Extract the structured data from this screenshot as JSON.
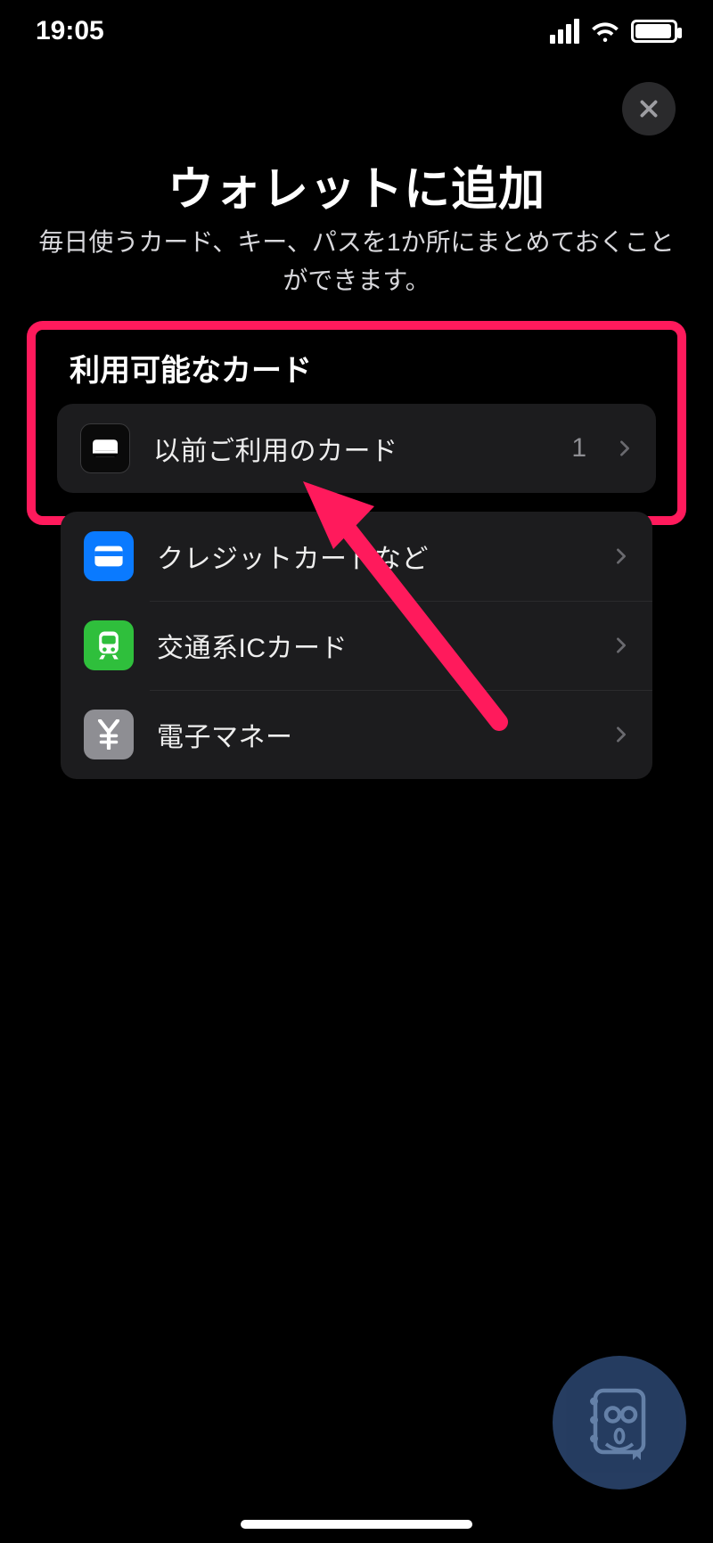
{
  "status": {
    "time": "19:05"
  },
  "close_label": "閉じる",
  "title": "ウォレットに追加",
  "subtitle": "毎日使うカード、キー、パスを1か所にまとめておくことができます。",
  "available": {
    "header": "利用可能なカード",
    "row": {
      "label": "以前ご利用のカード",
      "count": "1"
    }
  },
  "types": {
    "credit": "クレジットカードなど",
    "transit": "交通系ICカード",
    "emoney": "電子マネー"
  },
  "colors": {
    "highlight": "#ff1a5c",
    "credit": "#0a7aff",
    "transit": "#2fbf3c",
    "emoney": "#8e8e93"
  }
}
